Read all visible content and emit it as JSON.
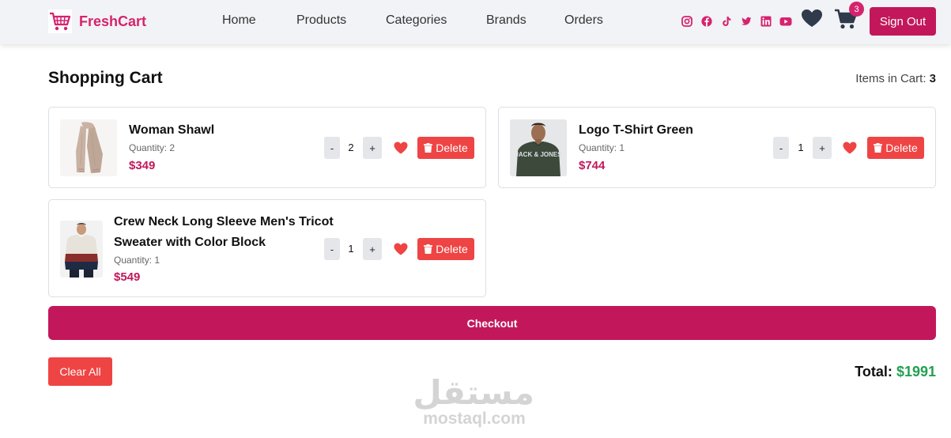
{
  "brand": {
    "name": "FreshCart",
    "icon": "shopping-cart-icon",
    "color": "#d6236e"
  },
  "nav": {
    "links": [
      "Home",
      "Products",
      "Categories",
      "Brands",
      "Orders"
    ],
    "socials": [
      "instagram-icon",
      "facebook-icon",
      "tiktok-icon",
      "twitter-icon",
      "linkedin-icon",
      "youtube-icon"
    ],
    "cart_count": "3",
    "sign_out": "Sign Out"
  },
  "cart": {
    "title": "Shopping Cart",
    "items_label": "Items in Cart:",
    "items_count": "3",
    "items": [
      {
        "name": "Woman Shawl",
        "quantity_label": "Quantity: 2",
        "qty": "2",
        "price": "$349",
        "minus": "-",
        "plus": "+",
        "delete": "Delete",
        "image": "shawl"
      },
      {
        "name": "Logo T-Shirt Green",
        "quantity_label": "Quantity: 1",
        "qty": "1",
        "price": "$744",
        "minus": "-",
        "plus": "+",
        "delete": "Delete",
        "image": "tshirt",
        "image_text": "JACK & JONES"
      },
      {
        "name": "Crew Neck Long Sleeve Men's Tricot Sweater with Color Block",
        "quantity_label": "Quantity: 1",
        "qty": "1",
        "price": "$549",
        "minus": "-",
        "plus": "+",
        "delete": "Delete",
        "image": "sweater"
      }
    ],
    "checkout": "Checkout",
    "clear_all": "Clear All",
    "total_label": "Total:",
    "total_value": "$1991"
  },
  "watermark": {
    "arabic": "مستقل",
    "latin": "mostaql.com"
  },
  "colors": {
    "accent": "#c2185b",
    "danger": "#ef4444",
    "success": "#22a052"
  }
}
